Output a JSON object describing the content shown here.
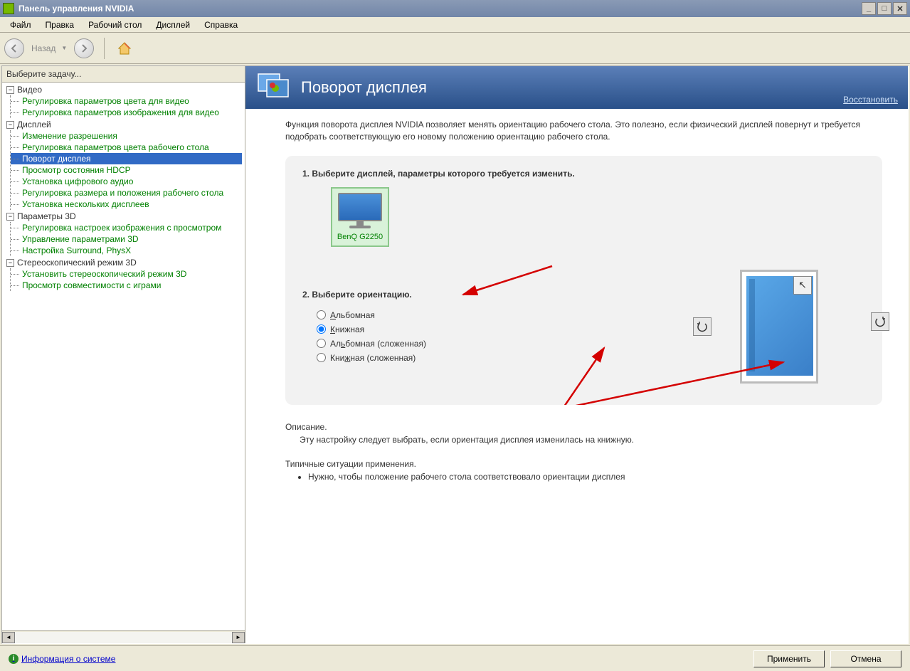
{
  "window": {
    "title": "Панель управления NVIDIA"
  },
  "menubar": [
    "Файл",
    "Правка",
    "Рабочий стол",
    "Дисплей",
    "Справка"
  ],
  "toolbar": {
    "back_label": "Назад"
  },
  "sidebar": {
    "header": "Выберите задачу...",
    "sections": [
      {
        "title": "Видео",
        "items": [
          "Регулировка параметров цвета для видео",
          "Регулировка параметров изображения для видео"
        ]
      },
      {
        "title": "Дисплей",
        "items": [
          "Изменение разрешения",
          "Регулировка параметров цвета рабочего стола",
          "Поворот дисплея",
          "Просмотр состояния HDCP",
          "Установка цифрового аудио",
          "Регулировка размера и положения рабочего стола",
          "Установка нескольких дисплеев"
        ],
        "selected_index": 2
      },
      {
        "title": "Параметры 3D",
        "items": [
          "Регулировка настроек изображения с просмотром",
          "Управление параметрами 3D",
          "Настройка Surround, PhysX"
        ]
      },
      {
        "title": "Стереоскопический режим 3D",
        "items": [
          "Установить стереоскопический режим 3D",
          "Просмотр совместимости с играми"
        ]
      }
    ]
  },
  "page": {
    "title": "Поворот дисплея",
    "restore": "Восстановить",
    "intro": "Функция поворота дисплея NVIDIA позволяет менять ориентацию рабочего стола. Это полезно, если физический дисплей повернут и требуется подобрать соответствующую его новому положению ориентацию рабочего стола.",
    "step1": "1. Выберите дисплей, параметры которого требуется изменить.",
    "display_name": "BenQ G2250",
    "step2": "2. Выберите ориентацию.",
    "orientations": [
      "Альбомная",
      "Книжная",
      "Альбомная (сложенная)",
      "Книжная (сложенная)"
    ],
    "selected_orientation": 1,
    "desc_heading": "Описание.",
    "desc_text": "Эту настройку следует выбрать, если ориентация дисплея изменилась на книжную.",
    "typical_heading": "Типичные ситуации применения.",
    "typical_item": "Нужно, чтобы положение рабочего стола соответствовало ориентации дисплея"
  },
  "footer": {
    "sysinfo": "Информация о системе",
    "apply": "Применить",
    "cancel": "Отмена"
  }
}
